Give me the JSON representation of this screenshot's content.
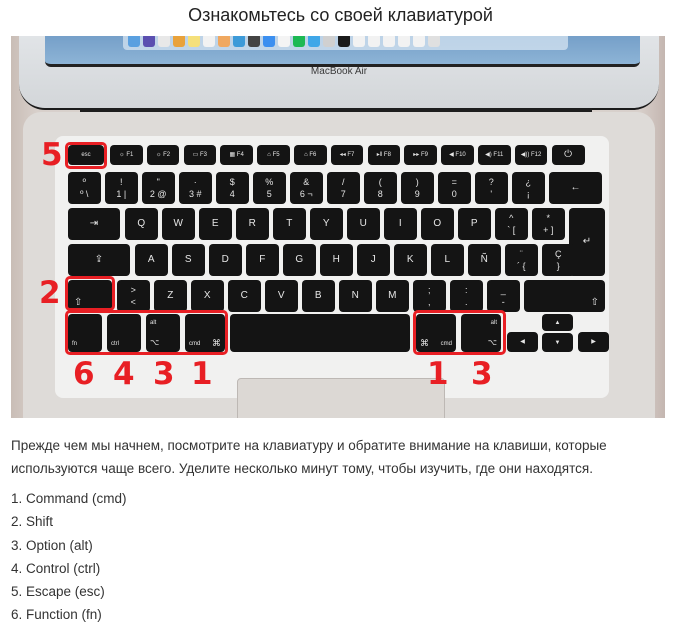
{
  "title": "Ознакомьтесь со своей клавиатурой",
  "photo": {
    "brand_label": "MacBook Air",
    "dock_colors": [
      "#5aa0e0",
      "#5a4fb0",
      "#e8e8e8",
      "#e9a23b",
      "#f5e07a",
      "#f2f2f2",
      "#f0a860",
      "#3c9ad8",
      "#444444",
      "#3b8ff0",
      "#f4f4f4",
      "#1db954",
      "#3fa7e8",
      "#d0d0d0",
      "#1a1a1a",
      "#f2f2f2",
      "#f2f2f2",
      "#f2f2f2",
      "#f2f2f2",
      "#f2f2f2",
      "#e0e0e0"
    ],
    "keys": {
      "esc": "esc",
      "f1": "☼ F1",
      "f2": "☼ F2",
      "f3": "▭ F3",
      "f4": "▦ F4",
      "f5": "⌂ F5",
      "f6": "⌂ F6",
      "f7": "◂◂ F7",
      "f8": "▸‖ F8",
      "f9": "▸▸ F9",
      "f10": "◀ F10",
      "f11": "◀) F11",
      "f12": "◀)) F12",
      "power": "⏻",
      "num_row": [
        [
          "º",
          "º \\"
        ],
        [
          "!",
          "1 |"
        ],
        [
          "\"",
          "2 @"
        ],
        [
          "·",
          "3 #"
        ],
        [
          "$",
          "4"
        ],
        [
          "%",
          "5"
        ],
        [
          "&",
          "6 ¬"
        ],
        [
          "/",
          "7"
        ],
        [
          "(",
          "8"
        ],
        [
          ")",
          "9"
        ],
        [
          "=",
          "0"
        ],
        [
          "?",
          "'"
        ],
        [
          "¿",
          "¡"
        ]
      ],
      "backspace": "←",
      "tab": "⇥",
      "q_row": [
        "Q",
        "W",
        "E",
        "R",
        "T",
        "Y",
        "U",
        "I",
        "O",
        "P"
      ],
      "q_row_extra": [
        [
          "^",
          "` ["
        ],
        [
          "*",
          "+ ]"
        ]
      ],
      "enter": "↵",
      "caps": "⇪",
      "a_row": [
        "A",
        "S",
        "D",
        "F",
        "G",
        "H",
        "J",
        "K",
        "L",
        "Ñ"
      ],
      "a_row_extra": [
        [
          "¨",
          "´ {"
        ],
        [
          "Ç",
          "}"
        ]
      ],
      "shift_left": "⇧",
      "angle": [
        ">",
        "<"
      ],
      "z_row": [
        "Z",
        "X",
        "C",
        "V",
        "B",
        "N",
        "M"
      ],
      "z_row_extra": [
        [
          ";",
          ","
        ],
        [
          ":",
          "."
        ],
        [
          "_",
          "-"
        ]
      ],
      "shift_right": "⇧",
      "fn": "fn",
      "ctrl": "ctrl",
      "alt_top": "alt",
      "option": "⌥",
      "cmd_label": "cmd",
      "cmd_symbol": "⌘",
      "arrow_up": "▲",
      "arrow_down": "▼",
      "arrow_left": "◀",
      "arrow_right": "▶"
    },
    "annotations": {
      "esc": "5",
      "shift": "2",
      "fn": "6",
      "ctrl": "4",
      "option_left": "3",
      "cmd_left": "1",
      "cmd_right": "1",
      "option_right": "3"
    },
    "highlight_color": "#e81f24"
  },
  "intro": "Прежде чем мы начнем, посмотрите на клавиатуру и обратите внимание на клавиши, которые используются чаще всего. Уделите несколько минут тому, чтобы изучить, где они находятся.",
  "key_list": [
    "1. Command (cmd)",
    "2. Shift",
    "3. Option (alt)",
    "4. Control (ctrl)",
    "5. Escape (esc)",
    "6. Function (fn)"
  ]
}
